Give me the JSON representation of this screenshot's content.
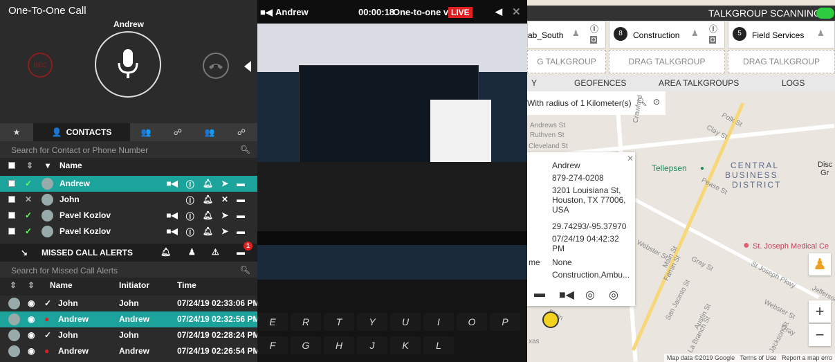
{
  "call": {
    "title": "One-To-One Call",
    "callee": "Andrew"
  },
  "contacts": {
    "tab_label": "CONTACTS",
    "search_placeholder": "Search for Contact or Phone Number",
    "col_name": "Name",
    "rows": [
      {
        "name": "Andrew",
        "selected": true
      },
      {
        "name": "John",
        "selected": false
      },
      {
        "name": "Pavel Kozlov",
        "selected": false
      },
      {
        "name": "Pavel Kozlov",
        "selected": false
      }
    ]
  },
  "missed": {
    "title": "MISSED CALL ALERTS",
    "badge": "1",
    "search_placeholder": "Search for Missed Call Alerts",
    "col_name": "Name",
    "col_initiator": "Initiator",
    "col_time": "Time",
    "rows": [
      {
        "name": "John",
        "initiator": "John",
        "time": "07/24/19 02:33:06 PM",
        "selected": false
      },
      {
        "name": "Andrew",
        "initiator": "Andrew",
        "time": "07/24/19 02:32:56 PM",
        "selected": true
      },
      {
        "name": "John",
        "initiator": "John",
        "time": "07/24/19 02:28:24 PM",
        "selected": false
      },
      {
        "name": "Andrew",
        "initiator": "Andrew",
        "time": "07/24/19 02:26:54 PM",
        "selected": false
      }
    ]
  },
  "video": {
    "name": "Andrew",
    "timer": "00:00:18",
    "title": "One-to-one vid...",
    "live": "LIVE"
  },
  "right": {
    "scanning": "TALKGROUP SCANNING",
    "talkgroups": [
      {
        "name": "ab_South",
        "badge": ""
      },
      {
        "name": "Construction",
        "badge": "8"
      },
      {
        "name": "Field Services",
        "badge": "5"
      }
    ],
    "drag1": "G TALKGROUP",
    "drag2": "DRAG TALKGROUP",
    "drag3": "DRAG TALKGROUP",
    "tabs": {
      "y": "Y",
      "geofences": "GEOFENCES",
      "area": "AREA TALKGROUPS",
      "logs": "LOGS"
    },
    "radius_label": "With radius of 1",
    "radius_unit": "Kilometer(s)",
    "popup": {
      "name": "Andrew",
      "phone": "879-274-0208",
      "address": "3201 Louisiana St, Houston, TX 77006, USA",
      "coords": "29.74293/-95.37970",
      "time": "07/24/19 04:42:32 PM",
      "l1": "me",
      "v1": "None",
      "v2": "Construction,Ambu..."
    },
    "map": {
      "tellepsen": "Tellepsen",
      "cbd1": "CENTRAL",
      "cbd2": "BUSINESS",
      "cbd3": "DISTRICT",
      "hospital": "St. Joseph Medical Ce",
      "disc": "Disc",
      "gr": "Gr",
      "streets": [
        "Andrews St",
        "Ruthven St",
        "Cleveland St",
        "Polk St",
        "Clay St",
        "Webster St",
        "Gray St",
        "Famin St",
        "San Jacinto St",
        "Austin St",
        "La Branch St",
        "St Joseph Pkwy",
        "Jefferson",
        "Pease St",
        "Elgin",
        "xas",
        "Main St",
        "Jackson St",
        "Webster St",
        "Gray",
        "Crawford"
      ]
    },
    "footer": {
      "data": "Map data ©2019 Google",
      "terms": "Terms of Use",
      "report": "Report a map erro"
    }
  },
  "colors": {
    "accent": "#1ba39c",
    "live": "#e02020",
    "toggle": "#2ecc40"
  }
}
